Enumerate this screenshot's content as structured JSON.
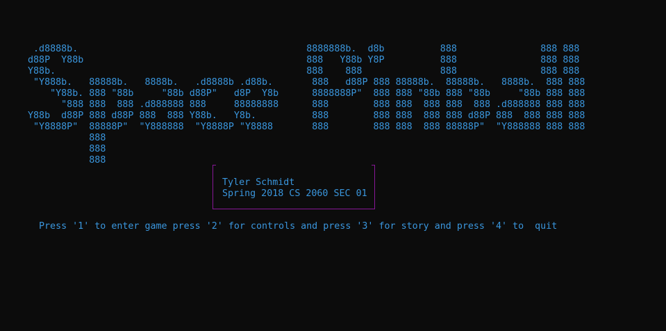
{
  "colors": {
    "background": "#0c0c0c",
    "text": "#3a96dd",
    "box_border": "#881798"
  },
  "banner": {
    "lines": [
      " .d8888b.                                         8888888b.  d8b          888               888 888",
      "d88P  Y88b                                        888   Y88b Y8P          888               888 888",
      "Y88b.                                             888    888              888               888 888",
      " \"Y888b.   88888b.   8888b.   .d8888b .d88b.       888   d88P 888 88888b.  88888b.   8888b.  888 888",
      "    \"Y88b. 888 \"88b     \"88b d88P\"   d8P  Y8b      8888888P\"  888 888 \"88b 888 \"88b     \"88b 888 888",
      "      \"888 888  888 .d888888 888     88888888      888        888 888  888 888  888 .d888888 888 888",
      "Y88b  d88P 888 d88P 888  888 Y88b.   Y8b.          888        888 888  888 888 d88P 888  888 888 888",
      " \"Y8888P\"  88888P\"  \"Y888888  \"Y8888P \"Y8888       888        888 888  888 88888P\"  \"Y888888 888 888",
      "           888",
      "           888",
      "           888"
    ]
  },
  "credits": {
    "name": "Tyler Schmidt",
    "course": "Spring 2018 CS 2060 SEC 01"
  },
  "prompt": {
    "text": "Press '1' to enter game press '2' for controls and press '3' for story and press '4' to  quit"
  }
}
